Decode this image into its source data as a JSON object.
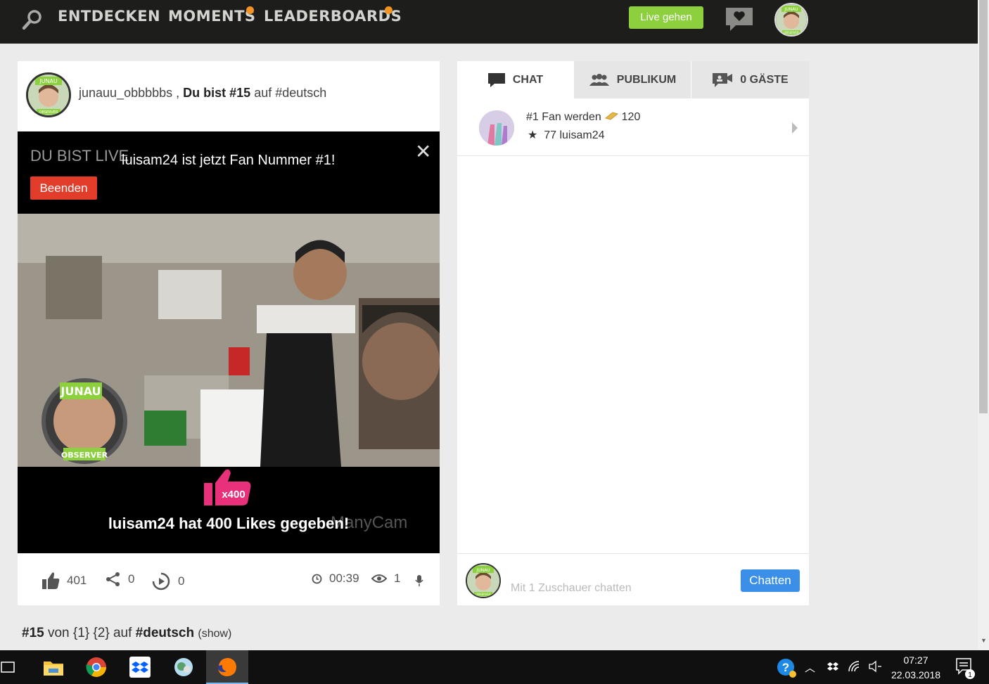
{
  "nav": {
    "items": [
      "ENTDECKEN",
      "MOMENTS",
      "LEADERBOARDS"
    ],
    "live_button": "Live gehen",
    "avatar_text_top": "JUNAU",
    "avatar_text_bottom": "OBSERVER"
  },
  "stream": {
    "username": "junauu_obbbbbs",
    "separator": " , ",
    "rank_text": "Du bist #15",
    "rank_suffix": " auf #deutsch",
    "live_label": "DU BIST LIVE",
    "fan_message": "luisam24 ist jetzt Fan Nummer #1!",
    "end_button": "Beenden",
    "like_badge": "x400",
    "likes_message": "luisam24 hat 400 Likes gegeben!",
    "watermark": "ManyCam",
    "overlay_text_top": "JUNAU",
    "overlay_text_bottom": "OBSERVER"
  },
  "stats": {
    "likes": "401",
    "shares": "0",
    "replays": "0",
    "duration": "00:39",
    "viewers": "1"
  },
  "ranking_line": {
    "rank": "#15",
    "middle": " von {1} {2} auf ",
    "tag": "#deutsch",
    "show": "(show)"
  },
  "tabs": [
    {
      "label": "CHAT",
      "active": true
    },
    {
      "label": "PUBLIKUM",
      "active": false
    },
    {
      "label": "0 GÄSTE",
      "active": false
    }
  ],
  "fan": {
    "line1": "#1 Fan werden",
    "coins": "120",
    "star": "★",
    "line2": "77 luisam24"
  },
  "chat": {
    "placeholder": "Mit 1 Zuschauer chatten",
    "send_button": "Chatten"
  },
  "taskbar": {
    "time": "07:27",
    "date": "22.03.2018",
    "notification_count": "1"
  },
  "colors": {
    "nav_bg": "#1d1d1b",
    "live_green": "#8cd03e",
    "notification_orange": "#f39322",
    "end_red": "#e23c2b",
    "chat_blue": "#3b8fe7",
    "like_pink": "#e8317a"
  }
}
